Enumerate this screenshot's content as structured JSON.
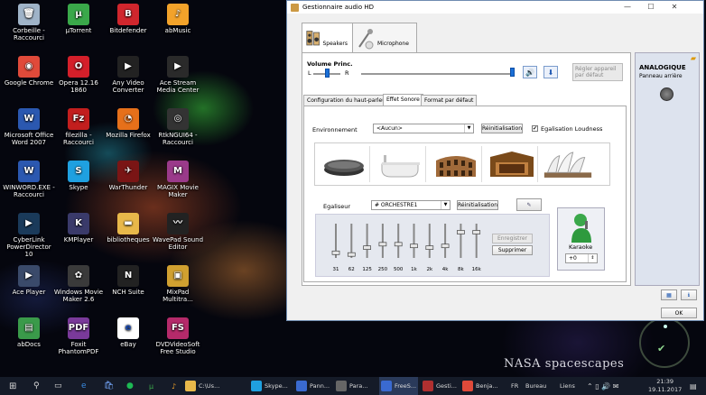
{
  "desktop": {
    "icons": [
      {
        "label": "Corbeille -\nRaccourci",
        "color": "#9fb3c8",
        "glyph": "🗑",
        "icon": "recycle-bin-icon"
      },
      {
        "label": "µTorrent",
        "color": "#3aa84a",
        "glyph": "µ",
        "icon": "utorrent-icon"
      },
      {
        "label": "Bitdefender",
        "color": "#d0262d",
        "glyph": "B",
        "icon": "bitdefender-icon"
      },
      {
        "label": "abMusic",
        "color": "#f2a22a",
        "glyph": "♪",
        "icon": "music-icon"
      },
      {
        "label": "Google Chrome",
        "color": "#e04a3a",
        "glyph": "◉",
        "icon": "chrome-icon"
      },
      {
        "label": "Opera 12.16 1860",
        "color": "#d41f2a",
        "glyph": "O",
        "icon": "opera-icon"
      },
      {
        "label": "Any Video\nConverter",
        "color": "#222222",
        "glyph": "▶",
        "icon": "video-converter-icon"
      },
      {
        "label": "Ace Stream\nMedia Center",
        "color": "#2a2a2a",
        "glyph": "▶",
        "icon": "ace-stream-icon"
      },
      {
        "label": "Microsoft Office\nWord 2007",
        "color": "#2b58b0",
        "glyph": "W",
        "icon": "word-icon"
      },
      {
        "label": "filezilla -\nRaccourci",
        "color": "#c21e1e",
        "glyph": "Fz",
        "icon": "filezilla-icon"
      },
      {
        "label": "Mozilla Firefox",
        "color": "#e6701a",
        "glyph": "◔",
        "icon": "firefox-icon"
      },
      {
        "label": "RtkNGUI64 -\nRaccourci",
        "color": "#333333",
        "glyph": "◎",
        "icon": "speaker-icon"
      },
      {
        "label": "WINWORD.EXE -\nRaccourci",
        "color": "#2b58b0",
        "glyph": "W",
        "icon": "word-shortcut-icon"
      },
      {
        "label": "Skype",
        "color": "#1fa0e0",
        "glyph": "S",
        "icon": "skype-icon"
      },
      {
        "label": "WarThunder",
        "color": "#7a1515",
        "glyph": "✈",
        "icon": "warthunder-icon"
      },
      {
        "label": "MAGIX Movie\nMaker",
        "color": "#9a3a8a",
        "glyph": "M",
        "icon": "magix-icon"
      },
      {
        "label": "CyberLink\nPowerDirector 10",
        "color": "#1a3a5a",
        "glyph": "▶",
        "icon": "powerdirector-icon"
      },
      {
        "label": "KMPlayer",
        "color": "#3a3a6a",
        "glyph": "K",
        "icon": "kmplayer-icon"
      },
      {
        "label": "bibliotheques",
        "color": "#e8b84a",
        "glyph": "▬",
        "icon": "folder-icon"
      },
      {
        "label": "WavePad Sound\nEditor",
        "color": "#222222",
        "glyph": "〰",
        "icon": "wavepad-icon"
      },
      {
        "label": "Ace Player",
        "color": "#3a4a6a",
        "glyph": "▶",
        "icon": "ace-player-icon"
      },
      {
        "label": "Windows Movie\nMaker 2.6",
        "color": "#3a3a3a",
        "glyph": "✿",
        "icon": "movie-maker-icon"
      },
      {
        "label": "NCH Suite",
        "color": "#222222",
        "glyph": "N",
        "icon": "nch-icon"
      },
      {
        "label": "MixPad\nMultitra...",
        "color": "#d0a030",
        "glyph": "▣",
        "icon": "mixpad-icon"
      },
      {
        "label": "abDocs",
        "color": "#3a9a4a",
        "glyph": "▤",
        "icon": "abdocs-icon"
      },
      {
        "label": "Foxit\nPhantomPDF",
        "color": "#7a3a9a",
        "glyph": "PDF",
        "icon": "foxit-icon"
      },
      {
        "label": "eBay",
        "color": "#ffffff",
        "glyph": "e",
        "icon": "ebay-icon"
      },
      {
        "label": "DVDVideoSoft\nFree Studio",
        "color": "#b52a6a",
        "glyph": "FS",
        "icon": "dvdvideosoft-icon"
      }
    ],
    "wallpaper_caption": "NASA spacescapes"
  },
  "window": {
    "title": "Gestionnaire audio HD",
    "tabs": [
      {
        "label": "Speakers",
        "icon": "speakers-icon"
      },
      {
        "label": "Microphone",
        "icon": "microphone-icon"
      }
    ],
    "volume": {
      "label": "Volume Princ.",
      "left": "L",
      "right": "R",
      "balance": 0.5,
      "level": 0.98
    },
    "default_device_label": "Régler appareil\npar défaut",
    "side": {
      "title": "ANALOGIQUE",
      "subtitle": "Panneau arrière"
    },
    "subtabs": [
      "Configuration du haut-parleur",
      "Effet Sonore",
      "Format par défaut"
    ],
    "environment": {
      "label": "Environnement",
      "value": "<Aucun>",
      "reset_label": "Réinitialisation",
      "loudness_label": "Egalisation Loudness",
      "loudness_checked": true,
      "scenes": [
        "stone-icon",
        "bathtub-icon",
        "colosseum-icon",
        "opera-house-arena-icon",
        "sydney-opera-icon"
      ]
    },
    "equalizer": {
      "label": "Egaliseur",
      "preset": "# ORCHESTRE1",
      "reset_label": "Réinitialisation",
      "save_label": "Enregistrer",
      "delete_label": "Supprimer",
      "bands": [
        "31",
        "62",
        "125",
        "250",
        "500",
        "1k",
        "2k",
        "4k",
        "8k",
        "16k"
      ],
      "levels": [
        0.15,
        0.1,
        0.3,
        0.4,
        0.4,
        0.35,
        0.3,
        0.35,
        0.75,
        0.75
      ]
    },
    "karaoke": {
      "label": "Karaoke",
      "value": "+0"
    },
    "ok_label": "OK"
  },
  "taskbar": {
    "items": [
      {
        "label": "C:\\Us...",
        "color": "#e8b84a",
        "icon": "explorer-icon"
      },
      {
        "label": "Skype...",
        "color": "#1fa0e0",
        "icon": "skype-task-icon"
      },
      {
        "label": "Pann...",
        "color": "#3a6ad0",
        "icon": "control-panel-icon"
      },
      {
        "label": "Para...",
        "color": "#666666",
        "icon": "settings-task-icon"
      },
      {
        "label": "FreeS...",
        "color": "#3a6ad0",
        "icon": "freestudio-task-icon"
      },
      {
        "label": "Gesti...",
        "color": "#b03030",
        "icon": "audio-manager-task-icon"
      },
      {
        "label": "Benja...",
        "color": "#e04a3a",
        "icon": "chrome-task-icon"
      }
    ],
    "lang": "FR",
    "desktop_label": "Bureau",
    "links_label": "Liens",
    "time": "21:39",
    "date": "19.11.2017"
  }
}
